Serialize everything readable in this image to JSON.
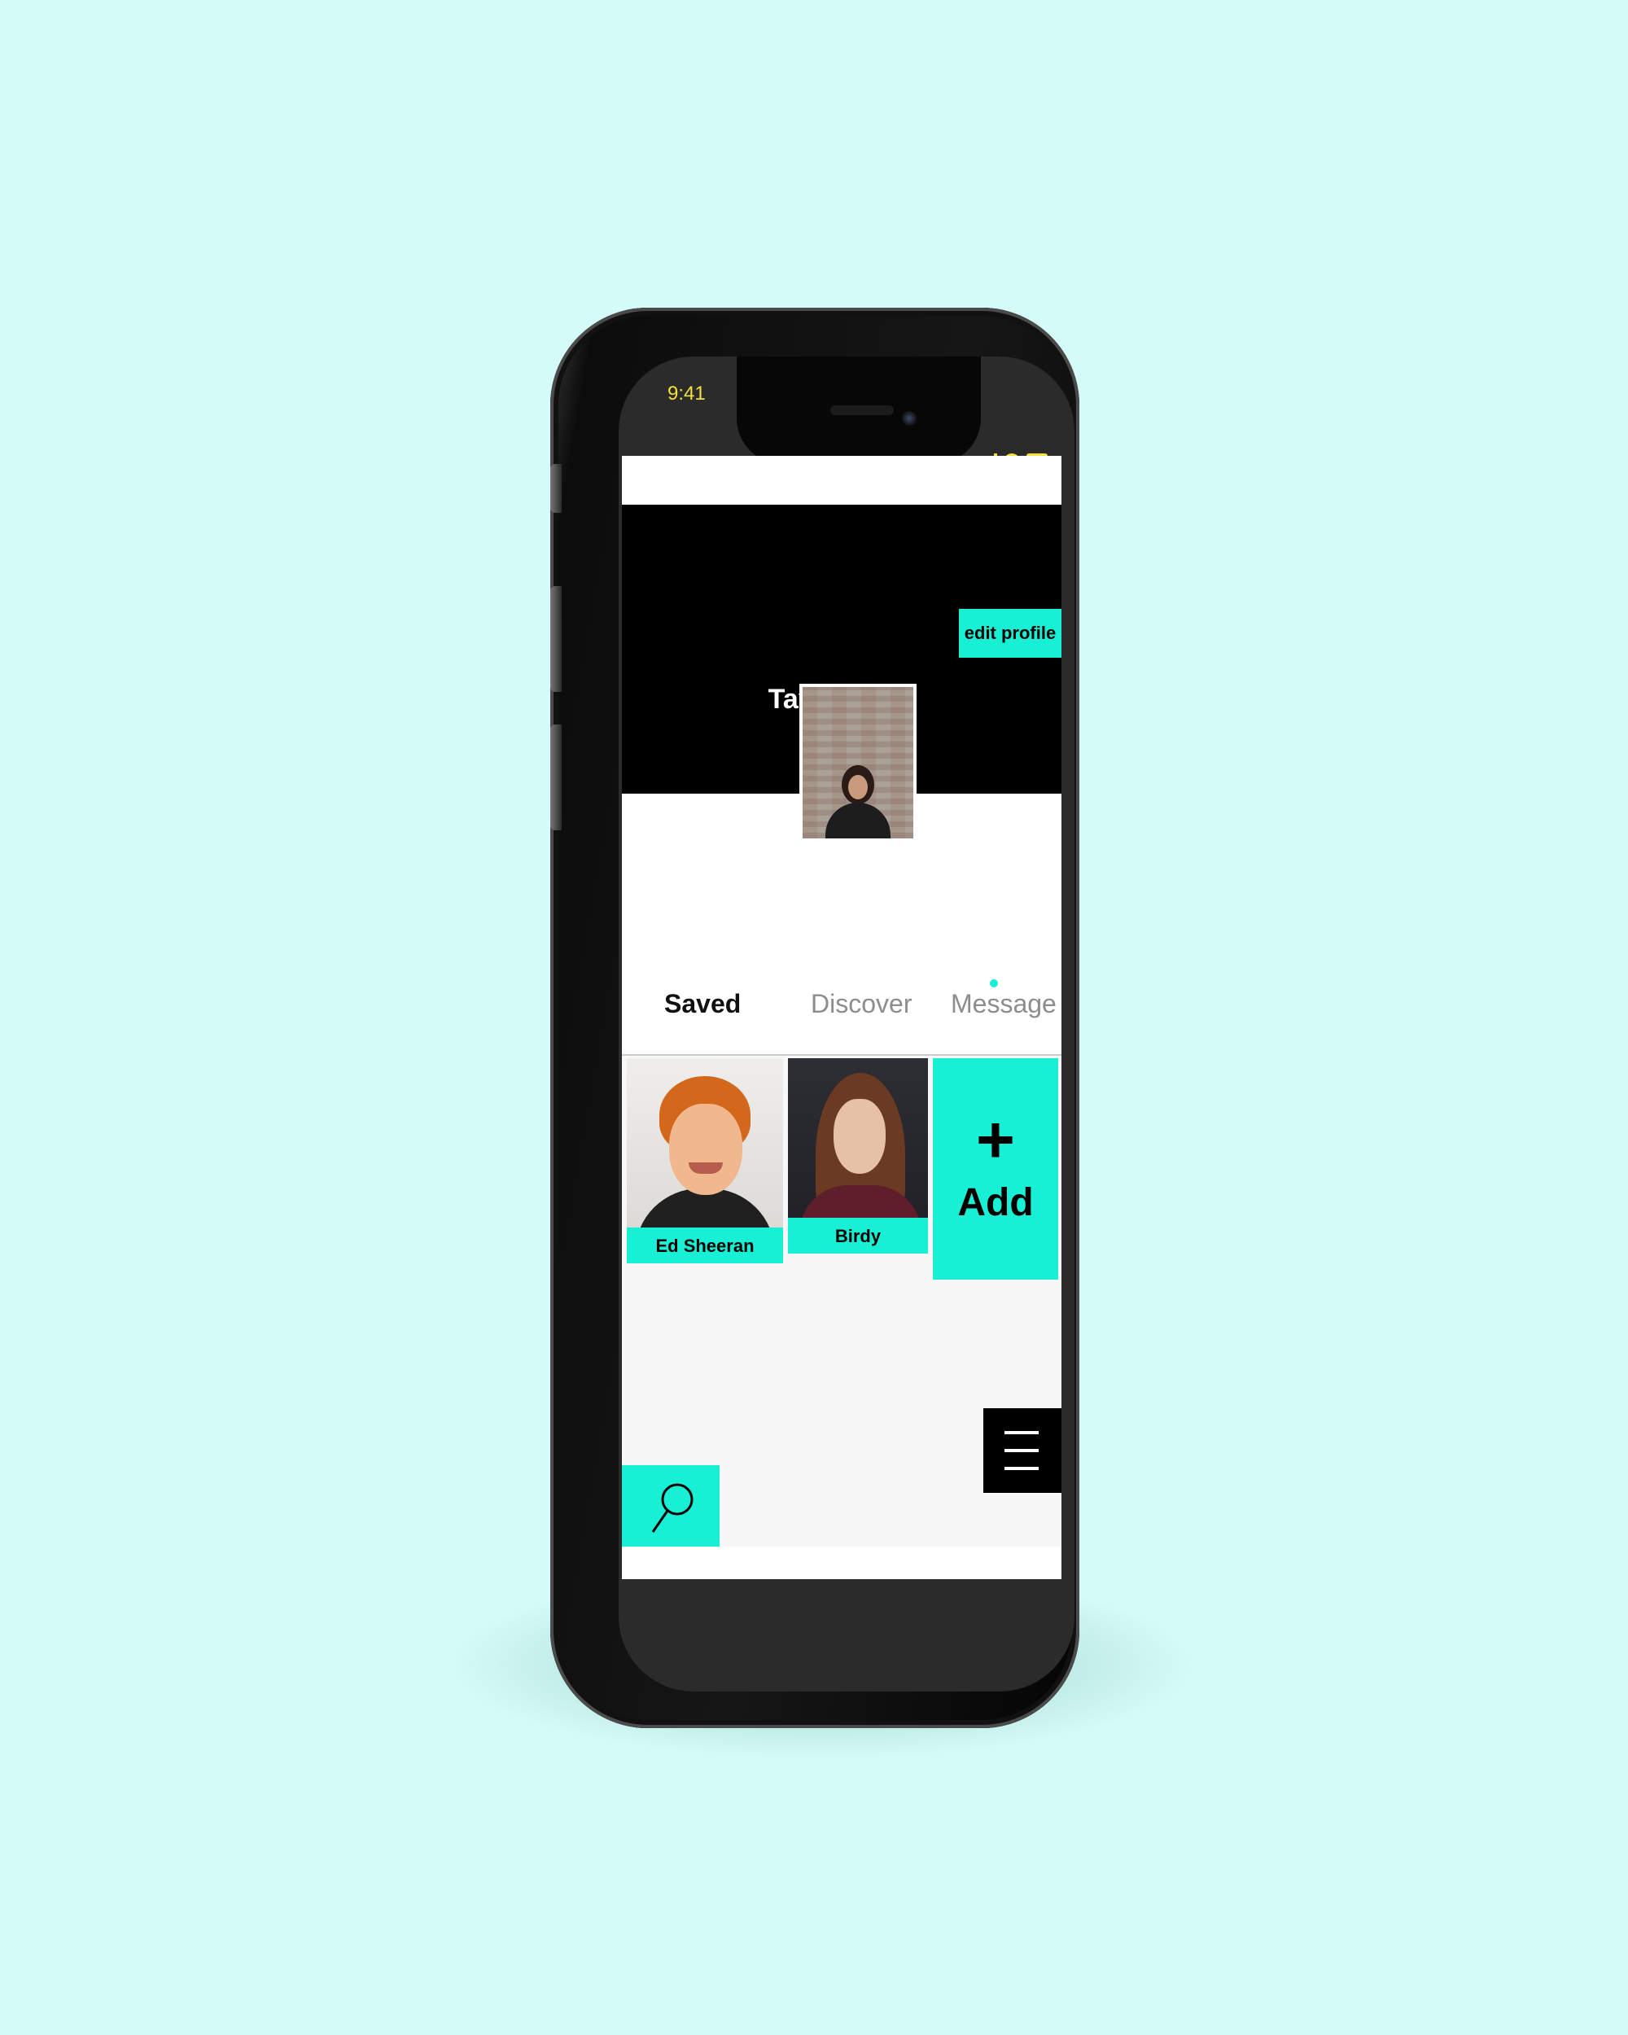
{
  "status_bar": {
    "time": "9:41"
  },
  "header": {
    "edit_profile_label": "edit profile",
    "user_name": "Taylor Figg"
  },
  "tabs": [
    {
      "label": "Saved",
      "active": true
    },
    {
      "label": "Discover",
      "active": false
    },
    {
      "label": "Message",
      "active": false,
      "has_notification": true
    }
  ],
  "saved_artists": [
    {
      "name": "Ed Sheeran"
    },
    {
      "name": "Birdy"
    }
  ],
  "add_card": {
    "plus": "+",
    "label": "Add"
  },
  "nav": {
    "search_icon": "search-icon",
    "menu_icon": "menu-icon"
  },
  "colors": {
    "accent": "#18f0d6",
    "background": "#d4fbf7",
    "header": "#000000",
    "status_text": "#f3e23a"
  }
}
